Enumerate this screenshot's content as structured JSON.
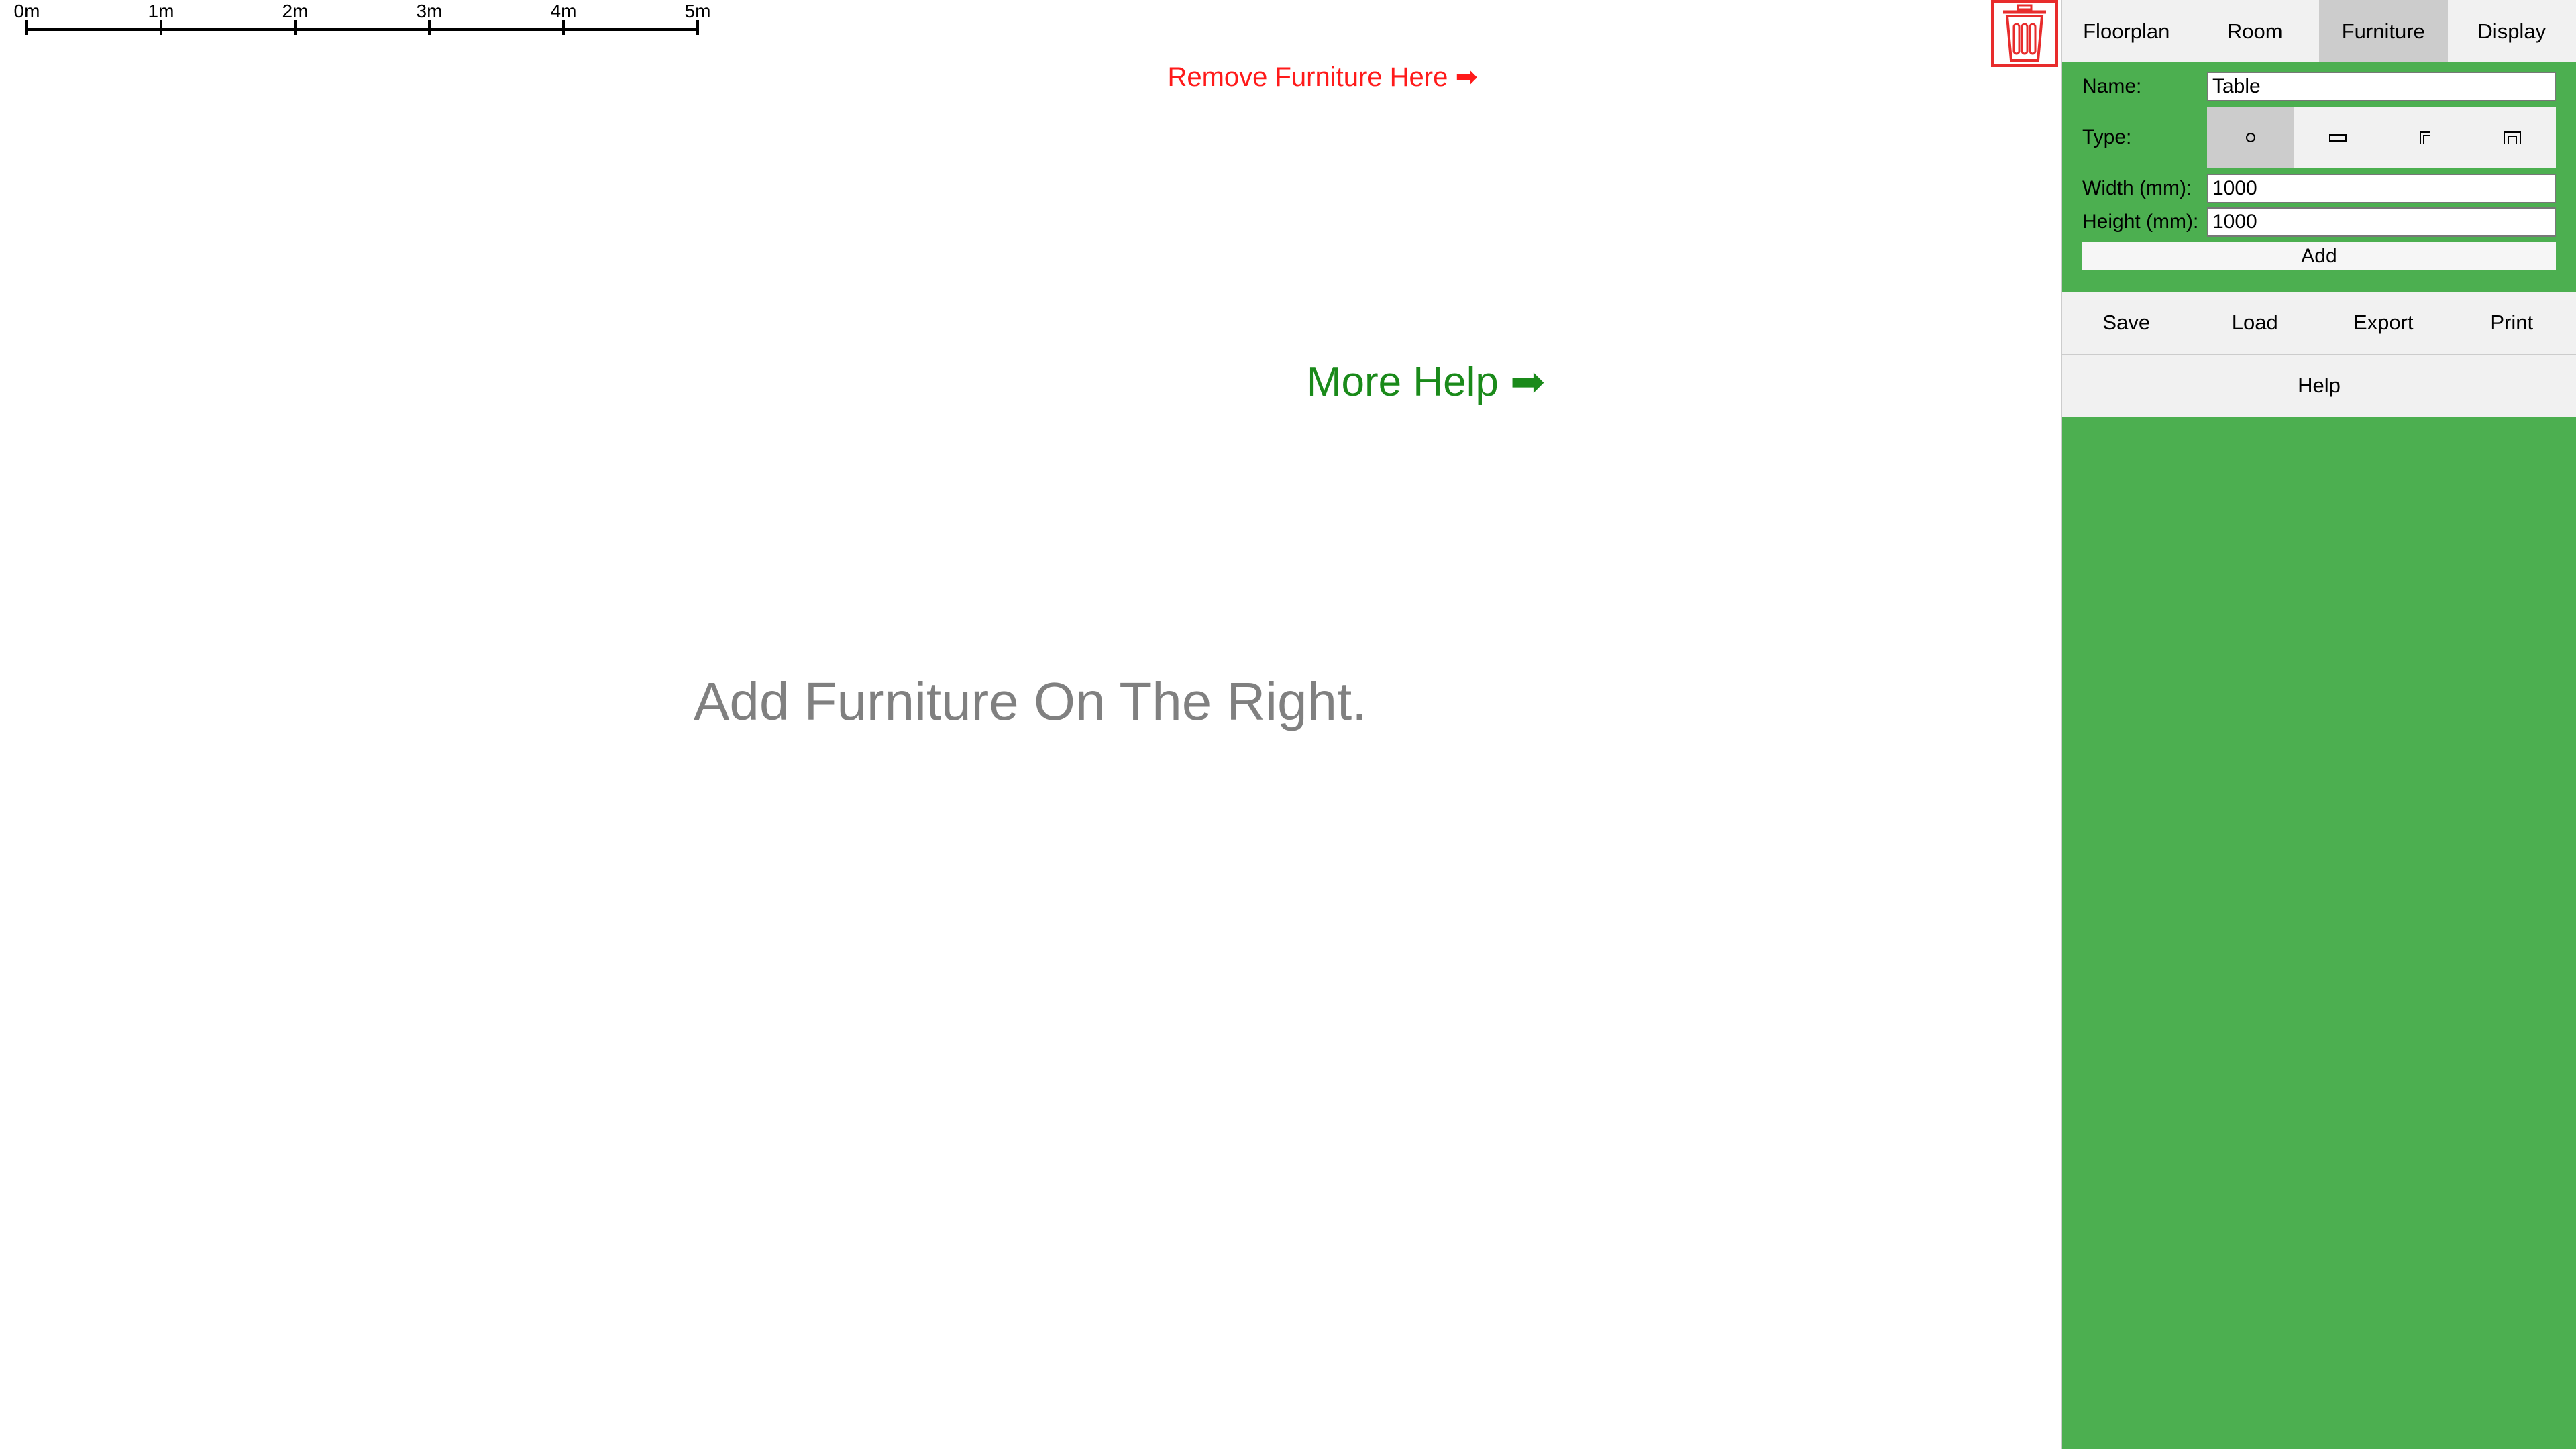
{
  "scale_bar": {
    "ticks": [
      "0m",
      "1m",
      "2m",
      "3m",
      "4m",
      "5m"
    ]
  },
  "canvas": {
    "hint": "Add Furniture On The Right.",
    "remove_label": "Remove Furniture Here ➡",
    "more_help": "More Help ➡"
  },
  "colors": {
    "panel_bg": "#4caf50",
    "remove_red": "#ff1a1a",
    "help_green": "#1a8a1a",
    "hint_grey": "#808080",
    "tab_active": "#cccccc"
  },
  "tabs": [
    {
      "label": "Floorplan",
      "active": false
    },
    {
      "label": "Room",
      "active": false
    },
    {
      "label": "Furniture",
      "active": true
    },
    {
      "label": "Display",
      "active": false
    }
  ],
  "form": {
    "name_label": "Name:",
    "name_value": "Table",
    "type_label": "Type:",
    "types": [
      {
        "icon": "circle-shape-icon",
        "active": true
      },
      {
        "icon": "rectangle-shape-icon",
        "active": false
      },
      {
        "icon": "corner-shape-icon",
        "active": false
      },
      {
        "icon": "u-shape-icon",
        "active": false
      }
    ],
    "width_label": "Width (mm):",
    "width_value": "1000",
    "height_label": "Height (mm):",
    "height_value": "1000",
    "add_label": "Add"
  },
  "file_actions": [
    "Save",
    "Load",
    "Export",
    "Print"
  ],
  "help_label": "Help"
}
